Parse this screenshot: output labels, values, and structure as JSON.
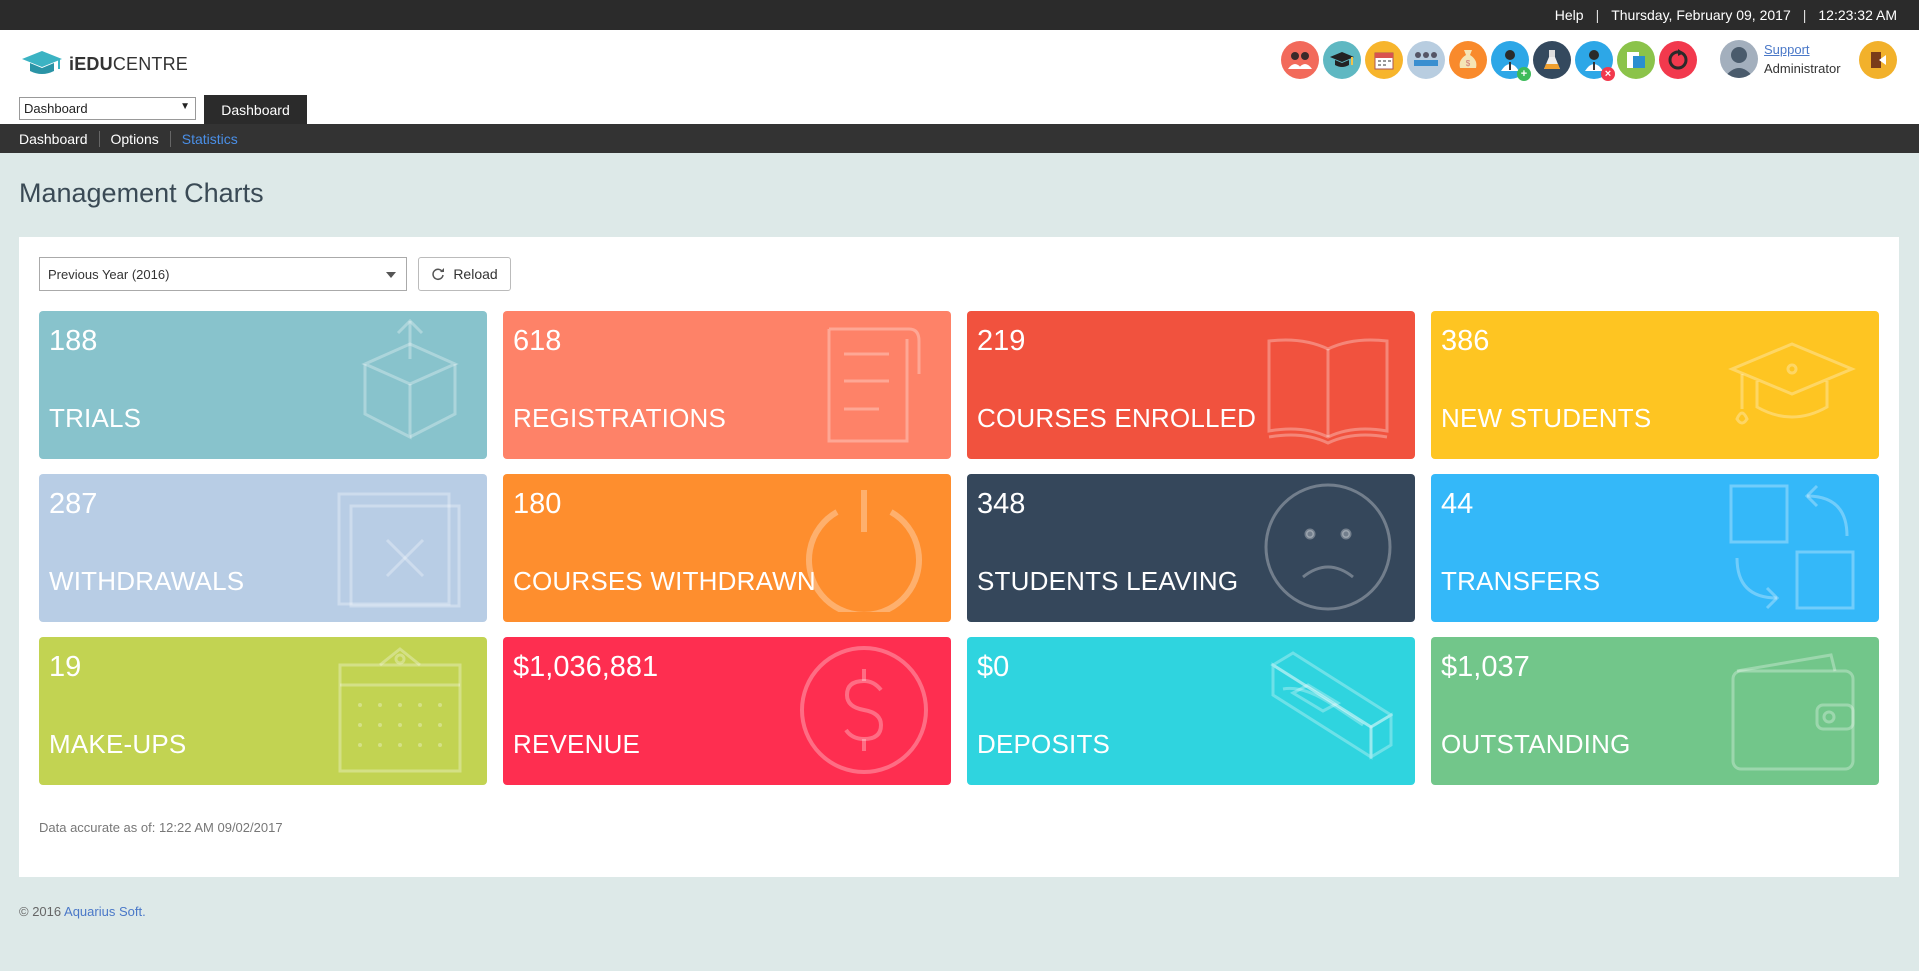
{
  "topbar": {
    "help": "Help",
    "separator": "|",
    "date": "Thursday, February 09, 2017",
    "time": "12:23:32 AM"
  },
  "logo": {
    "bold": "iEDU",
    "rest": "CENTRE"
  },
  "module_select": {
    "value": "Dashboard"
  },
  "active_tab": "Dashboard",
  "toolbar_icons": [
    {
      "name": "people-icon",
      "color": "#f26a5b"
    },
    {
      "name": "graduation-cap-icon",
      "color": "#5fb8c2"
    },
    {
      "name": "calendar-icon",
      "color": "#f7b52c"
    },
    {
      "name": "classroom-icon",
      "color": "#b8cde0"
    },
    {
      "name": "money-bag-icon",
      "color": "#f98a2c"
    },
    {
      "name": "add-student-icon",
      "color": "#2da7e7"
    },
    {
      "name": "lab-flask-icon",
      "color": "#34495e"
    },
    {
      "name": "remove-student-icon",
      "color": "#2da7e7"
    },
    {
      "name": "transfer-icon",
      "color": "#8bc34a"
    },
    {
      "name": "refresh-red-icon",
      "color": "#f2394d"
    }
  ],
  "user": {
    "link": "Support",
    "role": "Administrator"
  },
  "subnav": {
    "items": [
      "Dashboard",
      "Options",
      "Statistics"
    ]
  },
  "page_title": "Management Charts",
  "filter": {
    "period": "Previous Year (2016)",
    "reload_label": "Reload"
  },
  "tiles": [
    {
      "value": "188",
      "label": "TRIALS",
      "color": "#88c3cc",
      "icon": "box-icon"
    },
    {
      "value": "618",
      "label": "REGISTRATIONS",
      "color": "#fe8268",
      "icon": "document-icon"
    },
    {
      "value": "219",
      "label": "COURSES ENROLLED",
      "color": "#f1523e",
      "icon": "open-book-icon"
    },
    {
      "value": "386",
      "label": "NEW STUDENTS",
      "color": "#fec522",
      "icon": "graduation-cap-icon"
    },
    {
      "value": "287",
      "label": "WITHDRAWALS",
      "color": "#b8cde5",
      "icon": "cancel-window-icon"
    },
    {
      "value": "180",
      "label": "COURSES WITHDRAWN",
      "color": "#fe8e2e",
      "icon": "power-icon"
    },
    {
      "value": "348",
      "label": "STUDENTS LEAVING",
      "color": "#35475b",
      "icon": "sad-face-icon"
    },
    {
      "value": "44",
      "label": "TRANSFERS",
      "color": "#34b8f9",
      "icon": "transfer-arrows-icon"
    },
    {
      "value": "19",
      "label": "MAKE-UPS",
      "color": "#c2d352",
      "icon": "calendar-icon"
    },
    {
      "value": "$1,036,881",
      "label": "REVENUE",
      "color": "#fe2e50",
      "icon": "dollar-icon"
    },
    {
      "value": "$0",
      "label": "DEPOSITS",
      "color": "#2fd4df",
      "icon": "atm-slot-icon"
    },
    {
      "value": "$1,037",
      "label": "OUTSTANDING",
      "color": "#72c68a",
      "icon": "wallet-icon"
    }
  ],
  "note": "Data accurate as of: 12:22 AM 09/02/2017",
  "footer": {
    "copyright": "© 2016",
    "company": "Aquarius Soft."
  }
}
